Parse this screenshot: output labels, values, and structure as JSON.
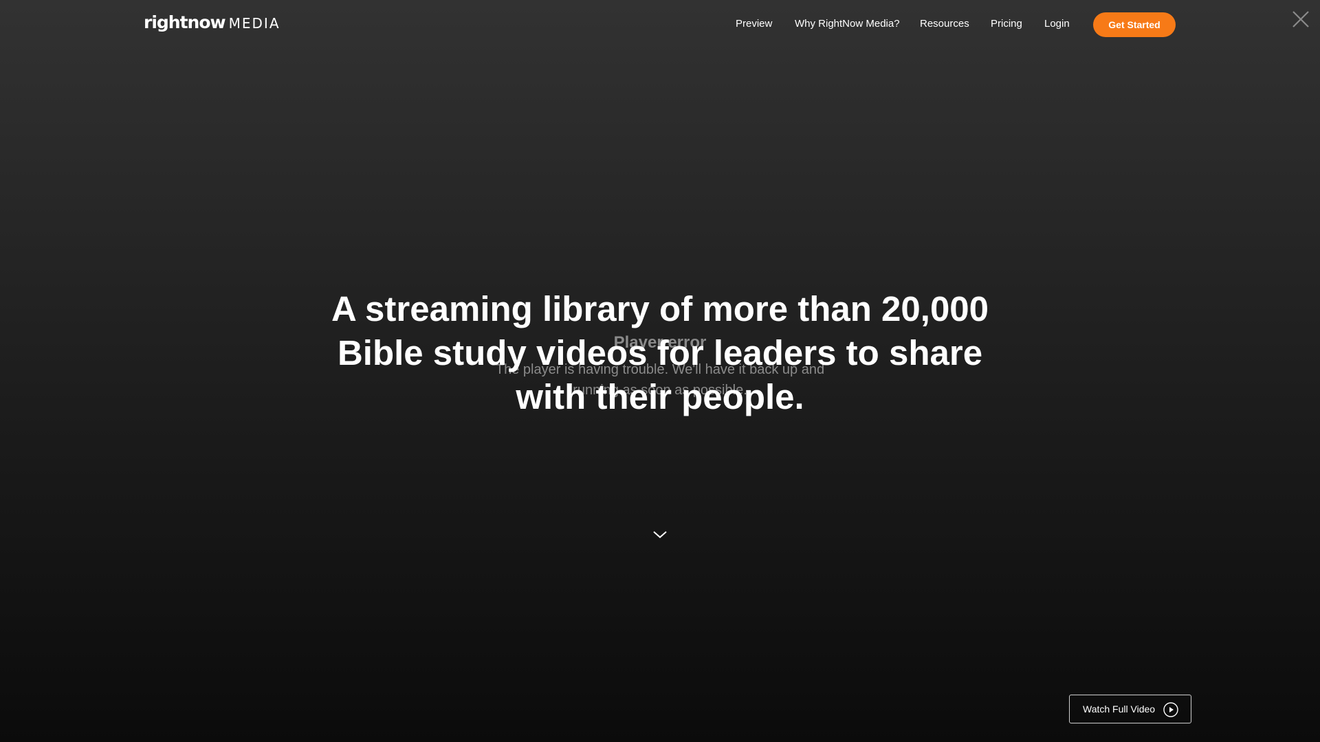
{
  "header": {
    "logo_word": "rightnow",
    "logo_suffix": "MEDIA",
    "nav": [
      {
        "label": "Preview"
      },
      {
        "label": "Why RightNow Media?"
      },
      {
        "label": "Resources"
      },
      {
        "label": "Pricing"
      },
      {
        "label": "Login"
      }
    ],
    "cta_label": "Get Started"
  },
  "player_error": {
    "title": "Player error",
    "message": "The player is having trouble. We'll have it back up and running as soon as possible."
  },
  "hero": {
    "headline": "A streaming library of more than 20,000 Bible study videos for leaders to share with their people."
  },
  "watch_button": {
    "label": "Watch Full Video"
  },
  "icons": {
    "close": "close-icon",
    "scroll": "chevron-down-icon",
    "play": "play-circle-icon"
  },
  "colors": {
    "accent": "#f77a17",
    "background_top": "#323232",
    "background_bottom": "#0b0b0b"
  }
}
